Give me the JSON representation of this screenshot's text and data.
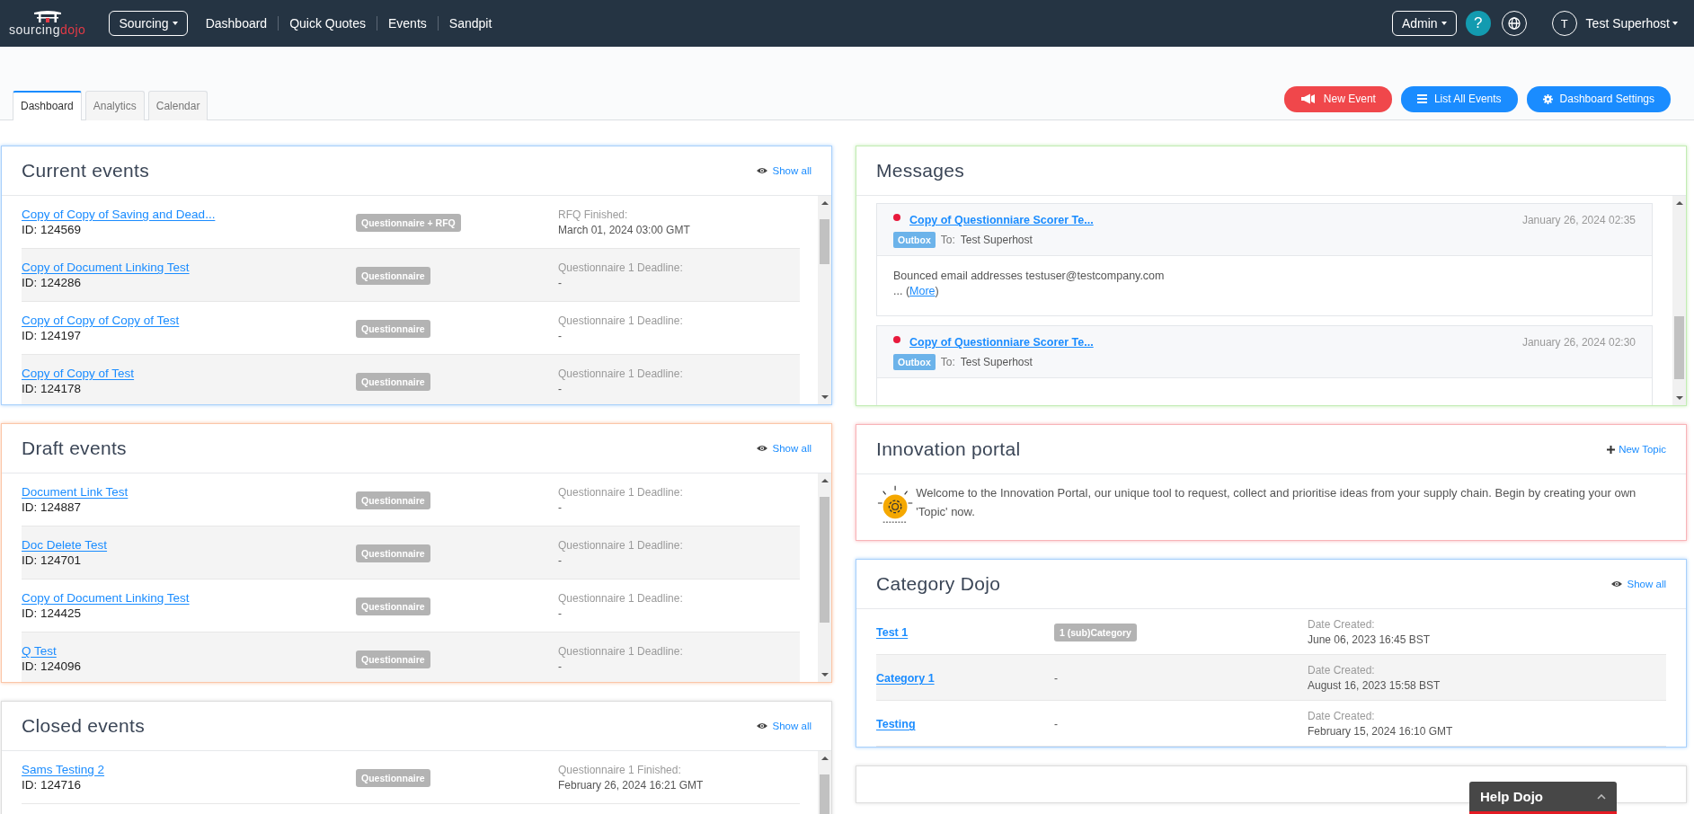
{
  "header": {
    "brand": [
      "sourcing",
      "dojo"
    ],
    "menu_button": "Sourcing",
    "nav": [
      "Dashboard",
      "Quick Quotes",
      "Events",
      "Sandpit"
    ],
    "admin_button": "Admin",
    "help_button": "?",
    "avatar": "T",
    "user": "Test Superhost"
  },
  "tabs": [
    {
      "label": "Dashboard",
      "selected": true
    },
    {
      "label": "Analytics",
      "selected": false
    },
    {
      "label": "Calendar",
      "selected": false
    }
  ],
  "actions": [
    {
      "label": "New Event",
      "kind": "new"
    },
    {
      "label": "List All Events",
      "kind": "list"
    },
    {
      "label": "Dashboard Settings",
      "kind": "settings"
    }
  ],
  "left_panels": [
    {
      "kind": "events",
      "title": "Current events",
      "color": "#a8d0fb",
      "show_all": "Show all",
      "rows": [
        {
          "name": "Copy of Copy of Saving and Dead...",
          "id": "ID: 124569",
          "tag": "Questionnaire + RFQ",
          "date_label": "RFQ Finished:",
          "date": "March 01, 2024 03:00 GMT"
        },
        {
          "name": "Copy of Document Linking Test",
          "id": "ID: 124286",
          "tag": "Questionnaire",
          "date_label": "Questionnaire 1 Deadline:",
          "date": "-"
        },
        {
          "name": "Copy of Copy of Copy of Test",
          "id": "ID: 124197",
          "tag": "Questionnaire",
          "date_label": "Questionnaire 1 Deadline:",
          "date": "-"
        },
        {
          "name": "Copy of Copy of Test",
          "id": "ID: 124178",
          "tag": "Questionnaire",
          "date_label": "Questionnaire 1 Deadline:",
          "date": "-"
        }
      ]
    },
    {
      "kind": "events",
      "title": "Draft events",
      "color": "#fbc6a8",
      "show_all": "Show all",
      "rows": [
        {
          "name": "Document Link Test",
          "id": "ID: 124887",
          "tag": "Questionnaire",
          "date_label": "Questionnaire 1 Deadline:",
          "date": "-"
        },
        {
          "name": "Doc Delete Test",
          "id": "ID: 124701",
          "tag": "Questionnaire",
          "date_label": "Questionnaire 1 Deadline:",
          "date": "-"
        },
        {
          "name": "Copy of Document Linking Test",
          "id": "ID: 124425",
          "tag": "Questionnaire",
          "date_label": "Questionnaire 1 Deadline:",
          "date": "-"
        },
        {
          "name": "Q Test",
          "id": "ID: 124096",
          "tag": "Questionnaire",
          "date_label": "Questionnaire 1 Deadline:",
          "date": "-"
        }
      ]
    },
    {
      "kind": "events",
      "title": "Closed events",
      "color": "#dddddd",
      "show_all": "Show all",
      "rows": [
        {
          "name": "Sams Testing 2",
          "id": "ID: 124716",
          "tag": "Questionnaire",
          "date_label": "Questionnaire 1 Finished:",
          "date": "February 26, 2024 16:21 GMT"
        }
      ]
    }
  ],
  "right_panels": [
    {
      "kind": "messages",
      "title": "Messages",
      "color": "#c3ecb4",
      "messages": [
        {
          "unread": true,
          "title": "Copy of Questionniare Scorer Te...",
          "folder": "Outbox",
          "to_label": "To:",
          "to": "Test Superhost",
          "date": "January 26, 2024 02:35",
          "body": "Bounced email addresses testuser@testcompany.com",
          "more_prefix": "... (",
          "more": "More",
          "more_suffix": ")"
        },
        {
          "unread": true,
          "title": "Copy of Questionniare Scorer Te...",
          "folder": "Outbox",
          "to_label": "To:",
          "to": "Test Superhost",
          "date": "January 26, 2024 02:30"
        }
      ]
    },
    {
      "kind": "innovation",
      "title": "Innovation portal",
      "color": "#f8b4b8",
      "new_topic": "New Topic",
      "text": "Welcome to the Innovation Portal, our unique tool to request, collect and prioritise ideas from your supply chain. Begin by creating your own 'Topic' now."
    },
    {
      "kind": "categories",
      "title": "Category Dojo",
      "color": "#a8d0fb",
      "show_all": "Show all",
      "rows": [
        {
          "name": "Test 1",
          "tag": "1 (sub)Category",
          "date_label": "Date Created:",
          "date": "June 06, 2023 16:45 BST"
        },
        {
          "name": "Category 1",
          "tag": "-",
          "date_label": "Date Created:",
          "date": "August 16, 2023 15:58 BST"
        },
        {
          "name": "Testing",
          "tag": "-",
          "date_label": "Date Created:",
          "date": "February 15, 2024 16:10 GMT"
        }
      ]
    },
    {
      "kind": "blank",
      "color": "#dddddd"
    }
  ],
  "help_widget": {
    "title": "Help Dojo"
  }
}
